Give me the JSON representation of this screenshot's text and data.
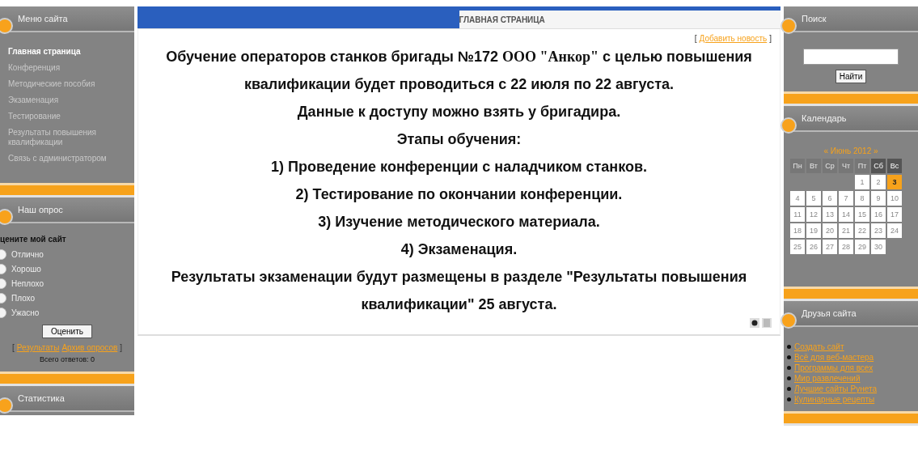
{
  "left_sidebar": {
    "menu": {
      "title": "Меню сайта",
      "items": [
        {
          "label": "Главная страница",
          "selected": true
        },
        {
          "label": "Конференция",
          "selected": false
        },
        {
          "label": "Методические пособия",
          "selected": false
        },
        {
          "label": "Экзаменация",
          "selected": false
        },
        {
          "label": "Тестирование",
          "selected": false
        },
        {
          "label": "Результаты повышения квалификации",
          "selected": false
        },
        {
          "label": "Связь с администратором",
          "selected": false
        }
      ]
    },
    "poll": {
      "title": "Наш опрос",
      "question": "цените мой сайт",
      "options": [
        {
          "label": "Отлично",
          "selected": false
        },
        {
          "label": "Хорошо",
          "selected": false
        },
        {
          "label": "Неплохо",
          "selected": false
        },
        {
          "label": "Плохо",
          "selected": false
        },
        {
          "label": "Ужасно",
          "selected": false
        }
      ],
      "button": "Оценить",
      "brackets": [
        "[",
        "]"
      ],
      "links": [
        "Результаты",
        "Архив опросов"
      ],
      "total": "Всего ответов: 0"
    },
    "stats": {
      "title": "Статистика"
    }
  },
  "main": {
    "header": "ГЛАВНАЯ СТРАНИЦА",
    "brackets": [
      "[",
      "]"
    ],
    "add_link": "Добавить новость",
    "lines": [
      "Обучение операторов станков бригады №172 ",
      "квалификации будет проводиться с 22 июля по 22 августа.",
      "Данные к доступу можно взять у бригадира.",
      "Этапы обучения:",
      "1) Проведение конференции с наладчиком станков.",
      "2) Тестирование по окончании конференции.",
      "3) Изучение методического материала.",
      "4) Экзаменация.",
      "Результаты экзаменации будут размещены в разделе \"Результаты повышения квалификации\" 25 августа."
    ],
    "company": "ООО \"Анкор\"",
    "first_line_tail": " с целью повышения"
  },
  "right_sidebar": {
    "search": {
      "title": "Поиск",
      "button": "Найти"
    },
    "calendar": {
      "title": "Календарь",
      "month": "« Июнь 2012 »",
      "weekdays": [
        {
          "label": "Пн",
          "weekend": false
        },
        {
          "label": "Вт",
          "weekend": false
        },
        {
          "label": "Ср",
          "weekend": false
        },
        {
          "label": "Чт",
          "weekend": false
        },
        {
          "label": "Пт",
          "weekend": false
        },
        {
          "label": "Сб",
          "weekend": true
        },
        {
          "label": "Вс",
          "weekend": true
        }
      ],
      "weeks": [
        [
          {
            "day": "1",
            "selected": false
          },
          {
            "day": "2",
            "selected": false
          },
          {
            "day": "3",
            "selected": true
          }
        ],
        [
          {
            "day": "4",
            "selected": false
          },
          {
            "day": "5",
            "selected": false
          },
          {
            "day": "6",
            "selected": false
          },
          {
            "day": "7",
            "selected": false
          },
          {
            "day": "8",
            "selected": false
          },
          {
            "day": "9",
            "selected": false
          },
          {
            "day": "10",
            "selected": false
          }
        ],
        [
          {
            "day": "11",
            "selected": false
          },
          {
            "day": "12",
            "selected": false
          },
          {
            "day": "13",
            "selected": false
          },
          {
            "day": "14",
            "selected": false
          },
          {
            "day": "15",
            "selected": false
          },
          {
            "day": "16",
            "selected": false
          },
          {
            "day": "17",
            "selected": false
          }
        ],
        [
          {
            "day": "18",
            "selected": false
          },
          {
            "day": "19",
            "selected": false
          },
          {
            "day": "20",
            "selected": false
          },
          {
            "day": "21",
            "selected": false
          },
          {
            "day": "22",
            "selected": false
          },
          {
            "day": "23",
            "selected": false
          },
          {
            "day": "24",
            "selected": false
          }
        ],
        [
          {
            "day": "25",
            "selected": false
          },
          {
            "day": "26",
            "selected": false
          },
          {
            "day": "27",
            "selected": false
          },
          {
            "day": "28",
            "selected": false
          },
          {
            "day": "29",
            "selected": false
          },
          {
            "day": "30",
            "selected": false
          }
        ]
      ]
    },
    "friends": {
      "title": "Друзья сайта",
      "links": [
        "Создать сайт",
        "Всё для веб-мастера",
        "Программы для всех",
        "Мир развлечений",
        "Лучшие сайты Рунета",
        "Кулинарные рецепты"
      ]
    }
  }
}
